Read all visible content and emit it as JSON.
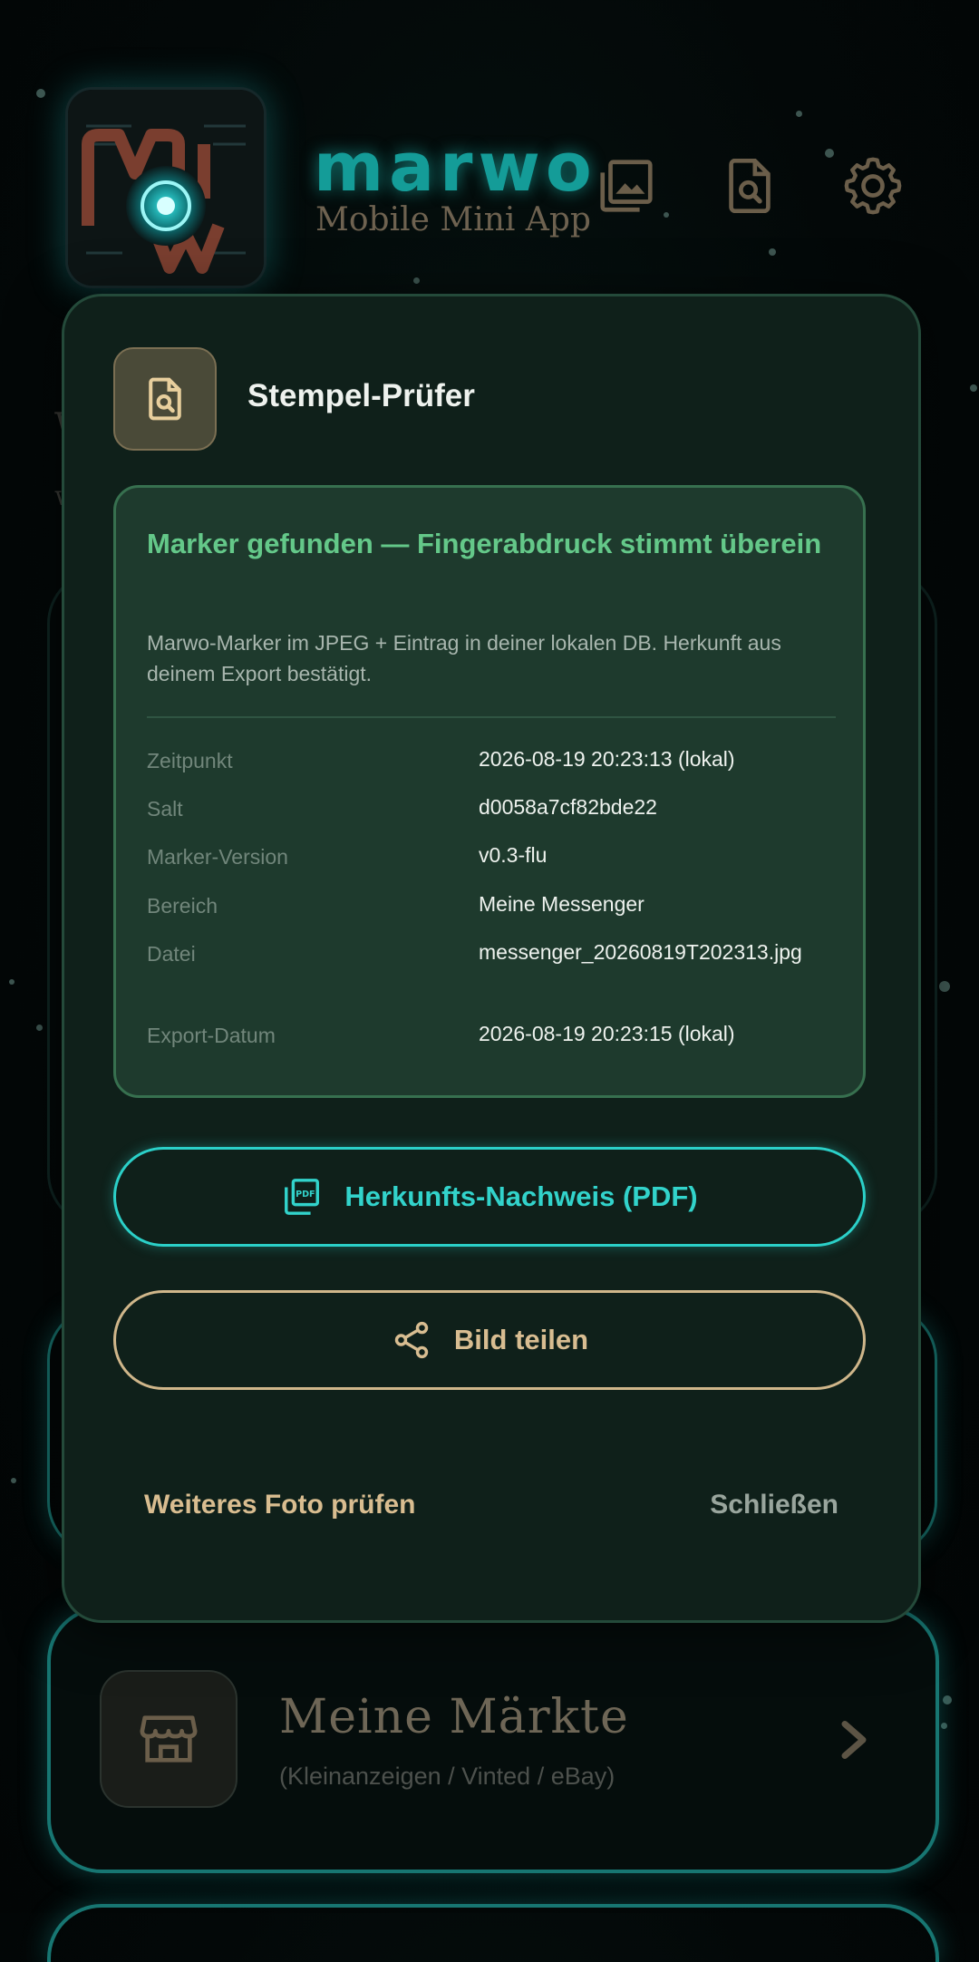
{
  "header": {
    "brand_title": "marwo",
    "brand_subtitle": "Mobile Mini App",
    "icons": [
      "gallery-icon",
      "stamp-check-icon",
      "gear-icon"
    ]
  },
  "dialog": {
    "title": "Stempel-Prüfer",
    "result": {
      "headline": "Marker gefunden — Fingerabdruck stimmt überein",
      "description": "Marwo-Marker im JPEG + Eintrag in deiner lokalen DB. Herkunft aus deinem Export bestätigt.",
      "rows": [
        {
          "key": "Zeitpunkt",
          "value": "2026-08-19 20:23:13 (lokal)"
        },
        {
          "key": "Salt",
          "value": "d0058a7cf82bde22"
        },
        {
          "key": "Marker-Version",
          "value": "v0.3-flu"
        },
        {
          "key": "Bereich",
          "value": "Meine Messenger"
        },
        {
          "key": "Datei",
          "value": "messenger_20260819T202313.jpg"
        },
        {
          "key": "Export-Datum",
          "value": "2026-08-19 20:23:15 (lokal)"
        }
      ]
    },
    "buttons": {
      "pdf_label": "Herkunfts-Nachweis (PDF)",
      "share_label": "Bild teilen",
      "check_another_label": "Weiteres Foto prüfen",
      "close_label": "Schließen"
    }
  },
  "background": {
    "market_card": {
      "title": "Meine Märkte",
      "subtitle": "(Kleinanzeigen / Vinted / eBay)"
    }
  },
  "colors": {
    "accent_teal": "#2bd0c8",
    "accent_gold": "#d8bd91",
    "success_green": "#64c889",
    "dialog_bg": "#0f201a"
  }
}
